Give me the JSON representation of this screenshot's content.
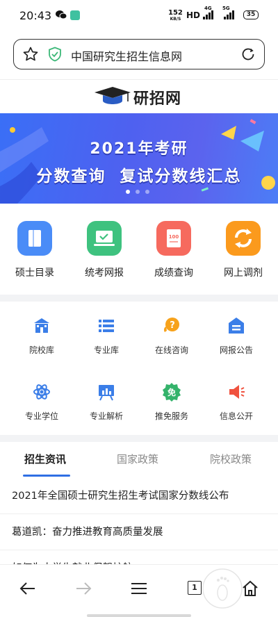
{
  "status_bar": {
    "time": "20:43",
    "net_speed_value": "152",
    "net_speed_unit": "KB/S",
    "hd": "HD",
    "sig1_tag": "4G",
    "sig2_tag": "5G",
    "battery": "35"
  },
  "address_bar": {
    "url_text": "中国研究生招生信息网"
  },
  "header": {
    "logo_text": "研招网"
  },
  "banner": {
    "line1": "2021年考研",
    "line2": "分数查询  复试分数线汇总",
    "active_slide": 1,
    "slide_count": 3
  },
  "quick_entries": [
    {
      "label": "硕士目录",
      "color": "#4a8cf7",
      "icon": "book-icon"
    },
    {
      "label": "统考网报",
      "color": "#3ec27f",
      "icon": "laptop-check-icon"
    },
    {
      "label": "成绩查询",
      "color": "#f66a5e",
      "icon": "score-sheet-icon"
    },
    {
      "label": "网上调剂",
      "color": "#fb9a1d",
      "icon": "swap-cycle-icon"
    }
  ],
  "services": [
    {
      "label": "院校库",
      "icon": "school-icon"
    },
    {
      "label": "专业库",
      "icon": "list-icon"
    },
    {
      "label": "在线咨询",
      "icon": "question-chat-icon"
    },
    {
      "label": "网报公告",
      "icon": "notice-icon"
    },
    {
      "label": "专业学位",
      "icon": "atom-icon"
    },
    {
      "label": "专业解析",
      "icon": "board-chart-icon"
    },
    {
      "label": "推免服务",
      "icon": "exempt-badge-icon"
    },
    {
      "label": "信息公开",
      "icon": "megaphone-icon"
    }
  ],
  "service_badge_char": "免",
  "tabs": [
    "招生资讯",
    "国家政策",
    "院校政策"
  ],
  "news": [
    "2021年全国硕士研究生招生考试国家分数线公布",
    "葛道凯：奋力推进教育高质量发展",
    "如何为大学生就业保驾护航"
  ],
  "bottom_nav": {
    "tab_count": "1"
  },
  "colors": {
    "accent": "#2f6fe4",
    "service_blue": "#3b7ee8",
    "service_orange": "#f7a21b",
    "service_green": "#34b36b",
    "service_red": "#f0523f"
  }
}
